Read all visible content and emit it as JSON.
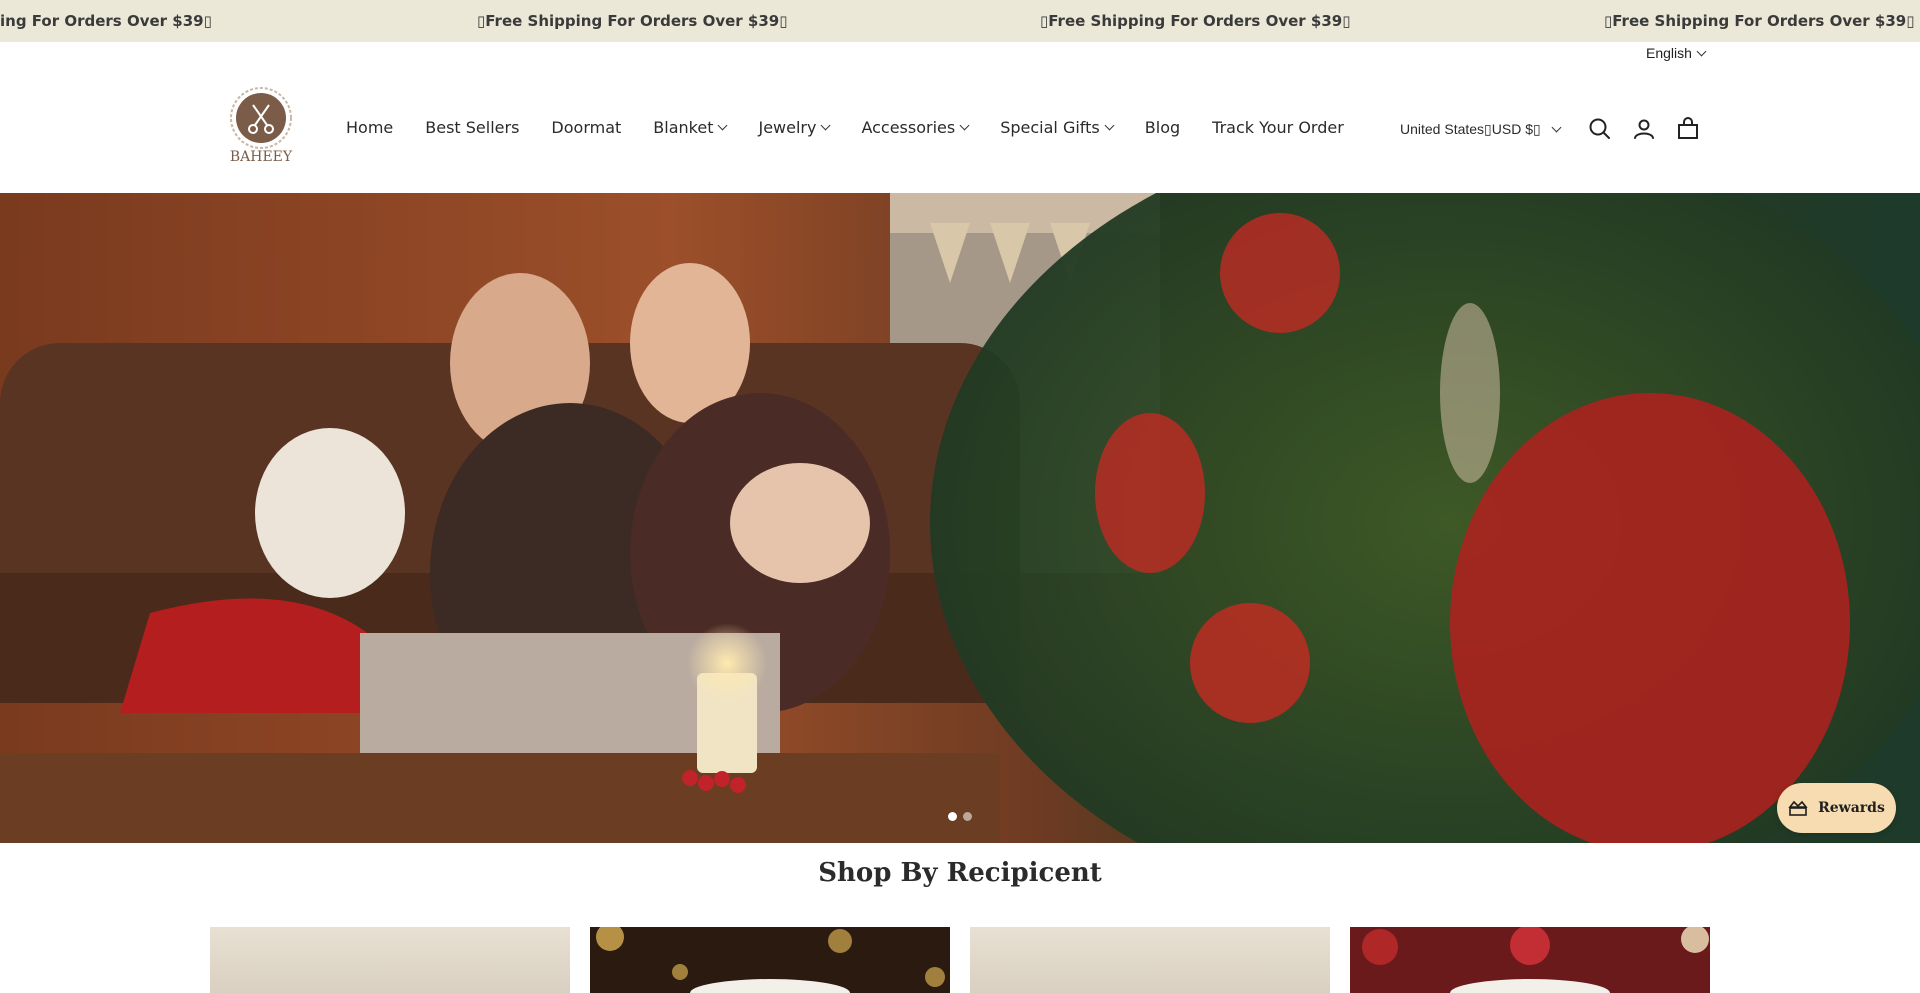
{
  "announcement": {
    "messages": [
      "Free Shipping For Orders Over $39",
      "Free Shipping For Orders Over $39",
      "Free Shipping For Orders Over $39",
      "Free Shipping For Orders Over $39"
    ],
    "first_partial": "ing For Orders Over $39",
    "glyph": "▯"
  },
  "language": {
    "label": "English"
  },
  "brand": {
    "name": "BAHEEY"
  },
  "nav": {
    "items": [
      {
        "label": "Home",
        "has_dropdown": false
      },
      {
        "label": "Best Sellers",
        "has_dropdown": false
      },
      {
        "label": "Doormat",
        "has_dropdown": false
      },
      {
        "label": "Blanket",
        "has_dropdown": true
      },
      {
        "label": "Jewelry",
        "has_dropdown": true
      },
      {
        "label": "Accessories",
        "has_dropdown": true
      },
      {
        "label": "Special Gifts",
        "has_dropdown": true
      },
      {
        "label": "Blog",
        "has_dropdown": false
      },
      {
        "label": "Track Your Order",
        "has_dropdown": false
      }
    ]
  },
  "currency": {
    "label": "United States▯USD $▯"
  },
  "header_icons": [
    "search-icon",
    "account-icon",
    "cart-icon"
  ],
  "hero": {
    "slide_count": 2,
    "active_slide": 1
  },
  "rewards": {
    "label": "Rewards"
  },
  "section": {
    "title": "Shop By Recipicent"
  },
  "colors": {
    "announcement_bg": "#ebe8d8",
    "rewards_bg": "#f6dcb0",
    "logo_brown": "#7a5c48"
  }
}
